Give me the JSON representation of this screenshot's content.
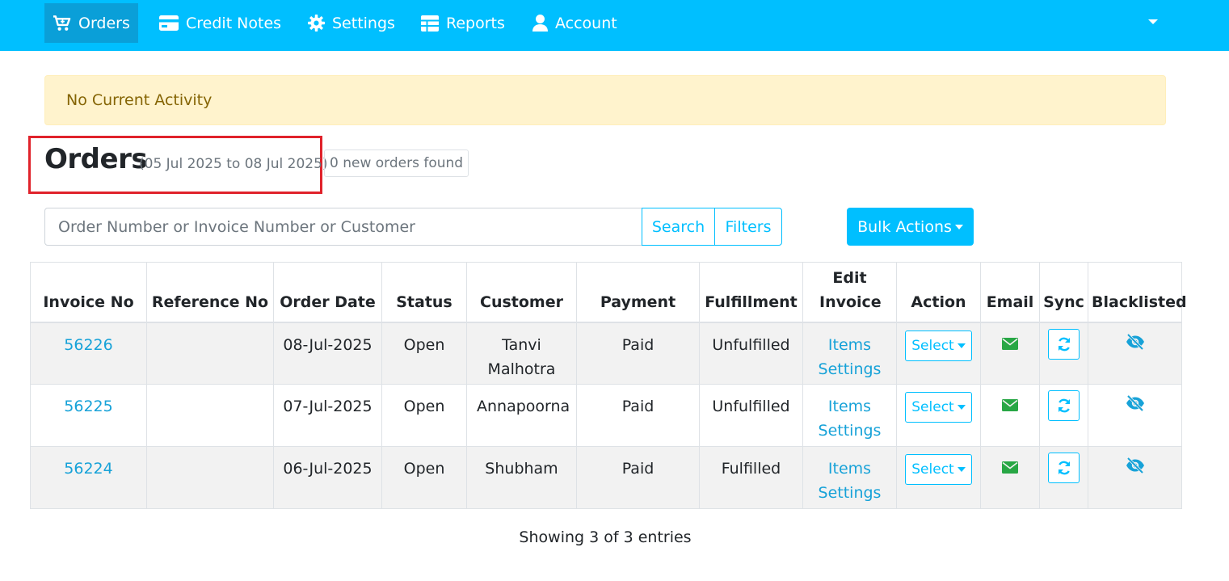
{
  "nav": {
    "items": [
      {
        "label": "Orders",
        "icon": "cart-icon"
      },
      {
        "label": "Credit Notes",
        "icon": "credit-card-icon"
      },
      {
        "label": "Settings",
        "icon": "gear-icon"
      },
      {
        "label": "Reports",
        "icon": "table-icon"
      },
      {
        "label": "Account",
        "icon": "user-icon"
      }
    ],
    "bg_color": "#00bfff"
  },
  "alert": {
    "text": "No Current Activity"
  },
  "page": {
    "title": "Orders",
    "date_range": "(05 Jul 2025 to 08 Jul 2025)",
    "new_orders": "0 new orders found"
  },
  "search": {
    "placeholder": "Order Number or Invoice Number or Customer",
    "value": "",
    "search_label": "Search",
    "filters_label": "Filters",
    "bulk_label": "Bulk Actions"
  },
  "table": {
    "headers": [
      "Invoice No",
      "Reference No",
      "Order Date",
      "Status",
      "Customer",
      "Payment",
      "Fulfillment",
      "Edit Invoice",
      "Action",
      "Email",
      "Sync",
      "Blacklisted"
    ],
    "rows": [
      {
        "invoice": "56226",
        "reference": "",
        "date": "08-Jul-2025",
        "status": "Open",
        "customer": "Tanvi Malhotra",
        "payment": "Paid",
        "fulfillment": "Unfulfilled",
        "edit_items": "Items",
        "edit_settings": "Settings",
        "action": "Select"
      },
      {
        "invoice": "56225",
        "reference": "",
        "date": "07-Jul-2025",
        "status": "Open",
        "customer": "Annapoorna",
        "payment": "Paid",
        "fulfillment": "Unfulfilled",
        "edit_items": "Items",
        "edit_settings": "Settings",
        "action": "Select"
      },
      {
        "invoice": "56224",
        "reference": "",
        "date": "06-Jul-2025",
        "status": "Open",
        "customer": "Shubham",
        "payment": "Paid",
        "fulfillment": "Fulfilled",
        "edit_items": "Items",
        "edit_settings": "Settings",
        "action": "Select"
      }
    ]
  },
  "footer": {
    "entries": "Showing 3 of 3 entries"
  },
  "colors": {
    "accent": "#00bfff",
    "link": "#17a2d8",
    "email_icon": "#28a745",
    "highlight_box": "#e0222b"
  }
}
